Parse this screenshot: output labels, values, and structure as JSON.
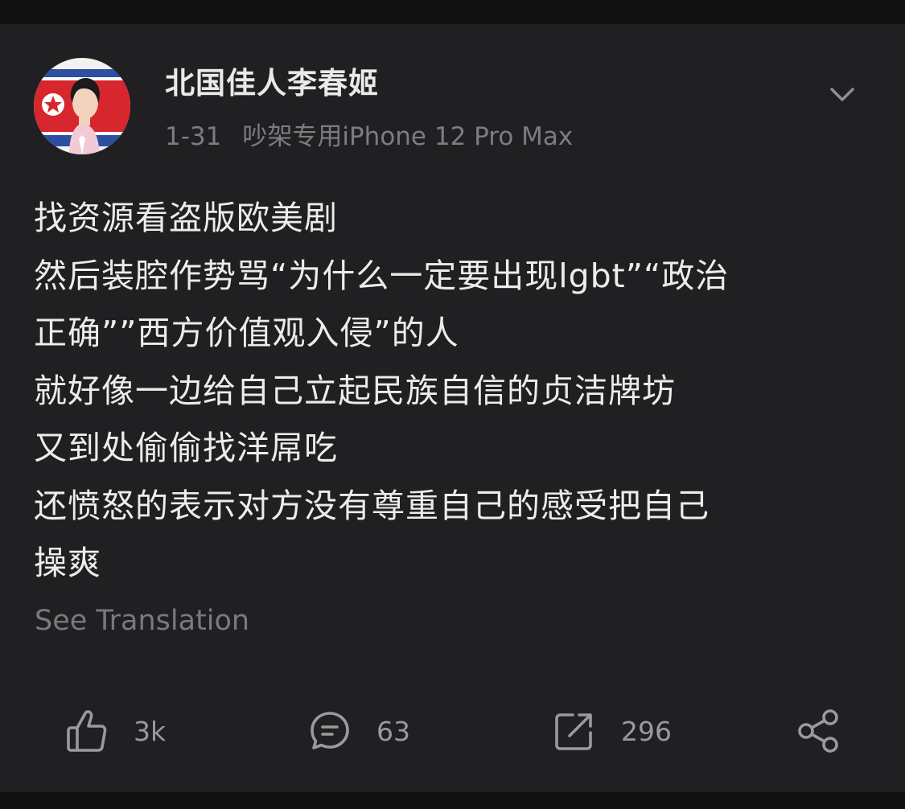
{
  "post": {
    "username": "北国佳人李春姬",
    "date": "1-31",
    "source": "吵架专用iPhone 12 Pro Max",
    "lines": [
      "找资源看盗版欧美剧",
      "然后装腔作势骂“为什么一定要出现lgbt”“政治",
      "正确””西方价值观入侵”的人",
      "就好像一边给自己立起民族自信的贞洁牌坊",
      "又到处偷偷找洋屌吃",
      "还愤怒的表示对方没有尊重自己的感受把自己",
      "操爽"
    ],
    "see_translation": "See Translation"
  },
  "actions": {
    "like_count": "3k",
    "comment_count": "63",
    "repost_count": "296"
  },
  "icons": {
    "more": "chevron-down-icon",
    "like": "thumbs-up-icon",
    "comment": "comment-icon",
    "repost": "repost-icon",
    "share": "share-icon"
  },
  "colors": {
    "background": "#121212",
    "card": "#202022",
    "text": "#ececec",
    "muted": "#7d7d80",
    "icon": "#9a9a9d"
  }
}
